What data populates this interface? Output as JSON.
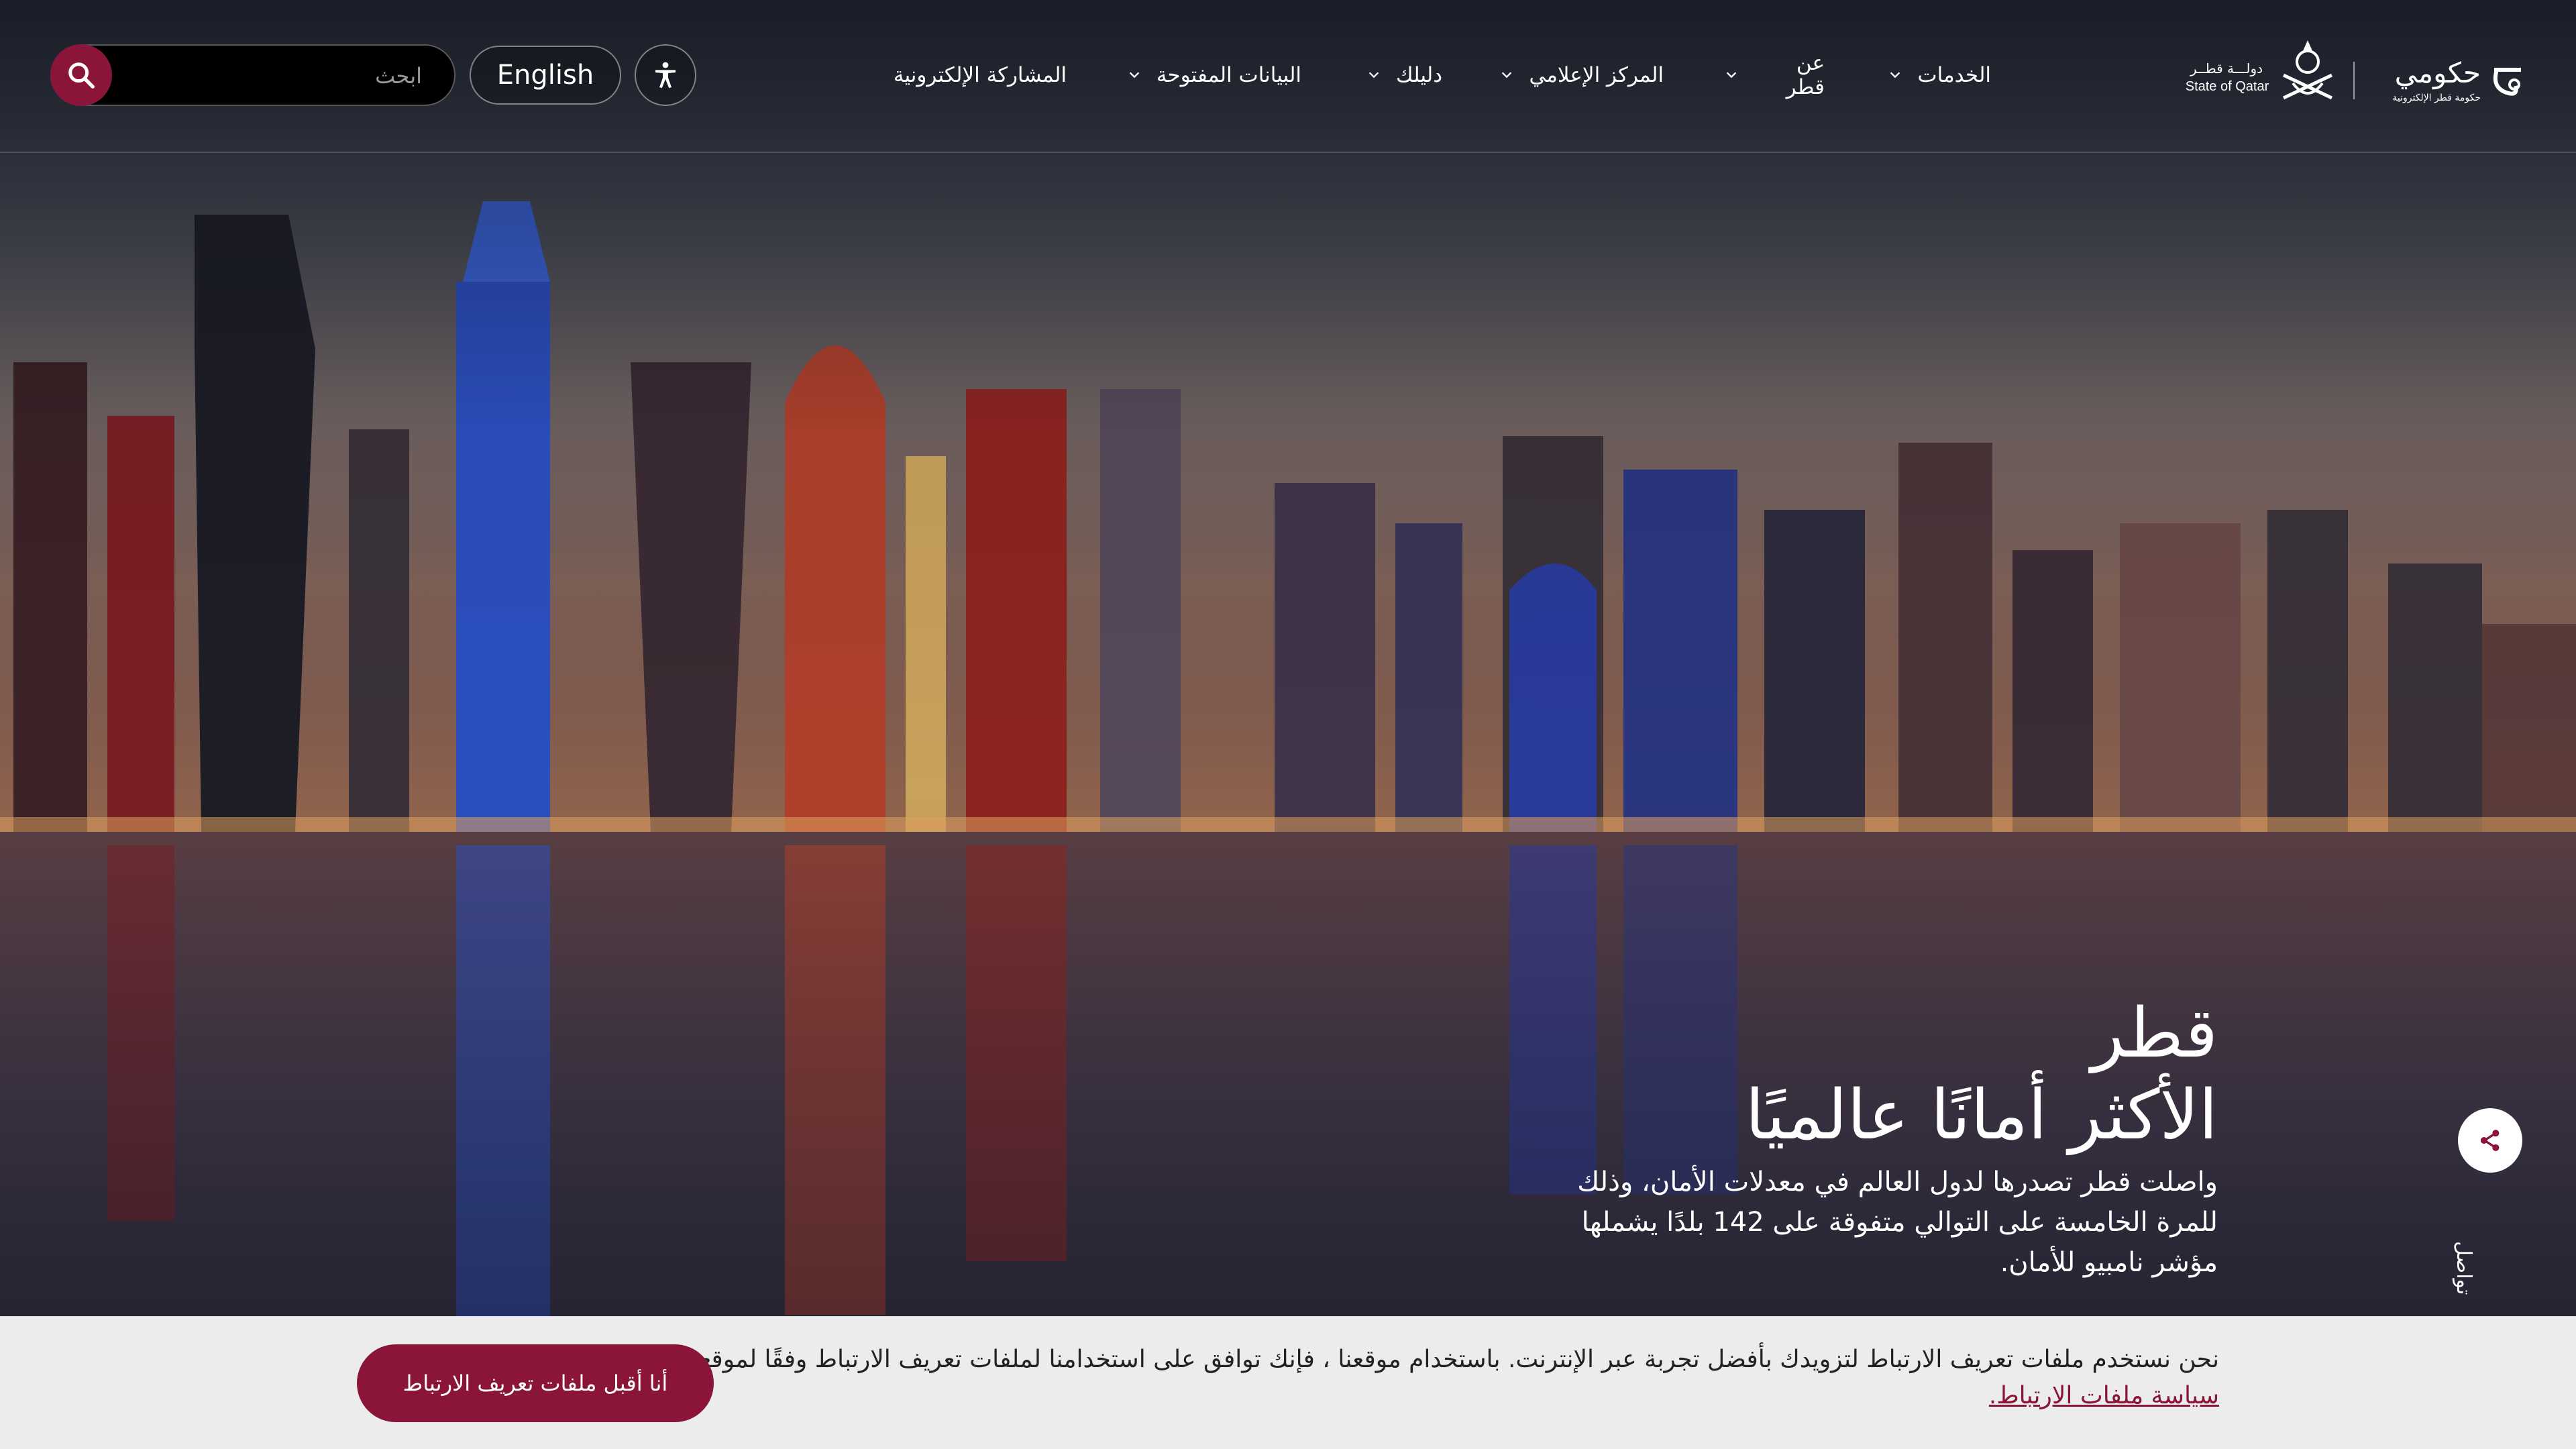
{
  "header": {
    "search": {
      "placeholder": "ابحث",
      "icon": "search-icon"
    },
    "language_button": "English",
    "accessibility_icon": "accessibility-icon",
    "nav": [
      {
        "label": "الخدمات",
        "icon": "chevron-down-icon"
      },
      {
        "label": "عن قطر",
        "icon": "chevron-down-icon"
      },
      {
        "label": "المركز الإعلامي",
        "icon": "chevron-down-icon"
      },
      {
        "label": "دليلك",
        "icon": "chevron-down-icon"
      },
      {
        "label": "البيانات المفتوحة",
        "icon": "chevron-down-icon"
      },
      {
        "label": "المشاركة الإلكترونية"
      }
    ],
    "logo_hukoomi": {
      "name": "حكومي",
      "tagline": "حكومة قطر الإلكترونية"
    },
    "logo_state": {
      "arabic": "دولـــة قطــر",
      "english": "State of Qatar"
    }
  },
  "hero": {
    "title_line1": "قطر",
    "title_line2": "الأكثر أمانًا عالميًا",
    "description": "واصلت قطر تصدرها لدول العالم في معدلات الأمان، وذلك للمرة الخامسة على التوالي متفوقة على 142 بلدًا يشملها مؤشر نامبيو للأمان."
  },
  "side": {
    "share_icon": "share-icon",
    "share_text": "تواصل"
  },
  "cookie": {
    "text": "نحن نستخدم ملفات تعريف الارتباط لتزويدك بأفضل تجربة عبر الإنترنت. باستخدام موقعنا ، فإنك توافق على استخدامنا لملفات تعريف الارتباط وفقًا لموقعنا",
    "link": "سياسة ملفات الارتباط.",
    "accept": "أنا أقبل ملفات تعريف الارتباط"
  },
  "colors": {
    "brand": "#8a1538",
    "cookie_bg": "#ececec",
    "header_text": "#ffffff"
  }
}
